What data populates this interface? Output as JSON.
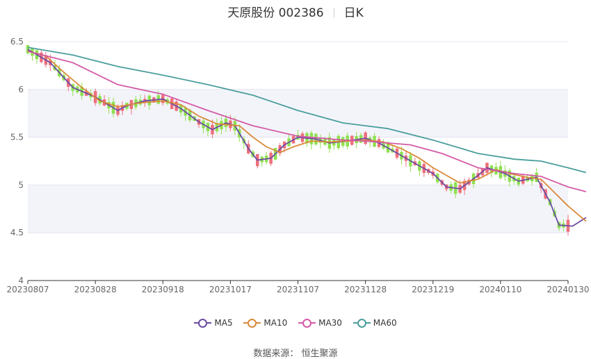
{
  "header": {
    "stock": "天原股份 002386",
    "period": "日K"
  },
  "source_label": "数据来源： 恒生聚源",
  "colors": {
    "up": "#ee6f7c",
    "down": "#8fe051",
    "ma5": "#6a4ca0",
    "ma10": "#d9893a",
    "ma30": "#d45aa6",
    "ma60": "#4a9e9c",
    "band": "#f3f4fa",
    "grid": "#e3e5ef"
  },
  "chart_data": {
    "type": "candlestick",
    "title": "天原股份 002386 日K",
    "y_range": [
      4,
      6.5
    ],
    "y_ticks": [
      "4",
      "4.5",
      "5",
      "5.5",
      "6",
      "6.5"
    ],
    "x_ticks": [
      "20230807",
      "20230828",
      "20230918",
      "20231017",
      "20231107",
      "20231128",
      "20231219",
      "20240110",
      "20240130"
    ],
    "legend": [
      "MA5",
      "MA10",
      "MA30",
      "MA60"
    ],
    "x_anchor_values": [
      0,
      15,
      30,
      45,
      60,
      75,
      90,
      105,
      120
    ],
    "series": [
      {
        "name": "MA5",
        "points": [
          [
            0,
            6.42
          ],
          [
            5,
            6.28
          ],
          [
            10,
            6.02
          ],
          [
            15,
            5.92
          ],
          [
            20,
            5.78
          ],
          [
            22,
            5.83
          ],
          [
            26,
            5.88
          ],
          [
            30,
            5.9
          ],
          [
            34,
            5.8
          ],
          [
            38,
            5.66
          ],
          [
            41,
            5.58
          ],
          [
            44,
            5.65
          ],
          [
            46,
            5.62
          ],
          [
            49,
            5.38
          ],
          [
            51,
            5.26
          ],
          [
            54,
            5.28
          ],
          [
            57,
            5.42
          ],
          [
            60,
            5.5
          ],
          [
            64,
            5.48
          ],
          [
            67,
            5.44
          ],
          [
            71,
            5.46
          ],
          [
            75,
            5.49
          ],
          [
            78,
            5.44
          ],
          [
            81,
            5.36
          ],
          [
            84,
            5.28
          ],
          [
            87,
            5.2
          ],
          [
            90,
            5.12
          ],
          [
            93,
            4.98
          ],
          [
            96,
            4.96
          ],
          [
            100,
            5.1
          ],
          [
            102,
            5.18
          ],
          [
            106,
            5.12
          ],
          [
            109,
            5.04
          ],
          [
            113,
            5.08
          ],
          [
            116,
            4.82
          ],
          [
            118,
            4.58
          ],
          [
            121,
            4.57
          ],
          [
            124,
            4.66
          ]
        ]
      },
      {
        "name": "MA10",
        "points": [
          [
            0,
            6.4
          ],
          [
            4,
            6.35
          ],
          [
            8,
            6.18
          ],
          [
            12,
            6.02
          ],
          [
            16,
            5.88
          ],
          [
            20,
            5.82
          ],
          [
            25,
            5.86
          ],
          [
            30,
            5.88
          ],
          [
            34,
            5.84
          ],
          [
            38,
            5.72
          ],
          [
            42,
            5.64
          ],
          [
            47,
            5.62
          ],
          [
            50,
            5.5
          ],
          [
            53,
            5.4
          ],
          [
            56,
            5.34
          ],
          [
            59,
            5.4
          ],
          [
            63,
            5.46
          ],
          [
            67,
            5.45
          ],
          [
            71,
            5.46
          ],
          [
            75,
            5.47
          ],
          [
            79,
            5.45
          ],
          [
            83,
            5.38
          ],
          [
            87,
            5.28
          ],
          [
            90,
            5.18
          ],
          [
            93,
            5.1
          ],
          [
            96,
            5.02
          ],
          [
            100,
            5.06
          ],
          [
            104,
            5.16
          ],
          [
            107,
            5.12
          ],
          [
            111,
            5.08
          ],
          [
            114,
            5.06
          ],
          [
            117,
            4.92
          ],
          [
            120,
            4.78
          ],
          [
            124,
            4.62
          ]
        ]
      },
      {
        "name": "MA30",
        "points": [
          [
            0,
            6.4
          ],
          [
            10,
            6.28
          ],
          [
            20,
            6.05
          ],
          [
            30,
            5.95
          ],
          [
            40,
            5.78
          ],
          [
            50,
            5.62
          ],
          [
            60,
            5.51
          ],
          [
            70,
            5.47
          ],
          [
            75,
            5.46
          ],
          [
            85,
            5.42
          ],
          [
            92,
            5.33
          ],
          [
            100,
            5.18
          ],
          [
            108,
            5.12
          ],
          [
            114,
            5.09
          ],
          [
            120,
            4.98
          ],
          [
            124,
            4.93
          ]
        ]
      },
      {
        "name": "MA60",
        "points": [
          [
            0,
            6.44
          ],
          [
            10,
            6.36
          ],
          [
            20,
            6.24
          ],
          [
            30,
            6.15
          ],
          [
            40,
            6.05
          ],
          [
            50,
            5.94
          ],
          [
            60,
            5.78
          ],
          [
            70,
            5.65
          ],
          [
            80,
            5.59
          ],
          [
            90,
            5.47
          ],
          [
            100,
            5.33
          ],
          [
            108,
            5.27
          ],
          [
            114,
            5.25
          ],
          [
            120,
            5.18
          ],
          [
            124,
            5.13
          ]
        ]
      }
    ]
  }
}
